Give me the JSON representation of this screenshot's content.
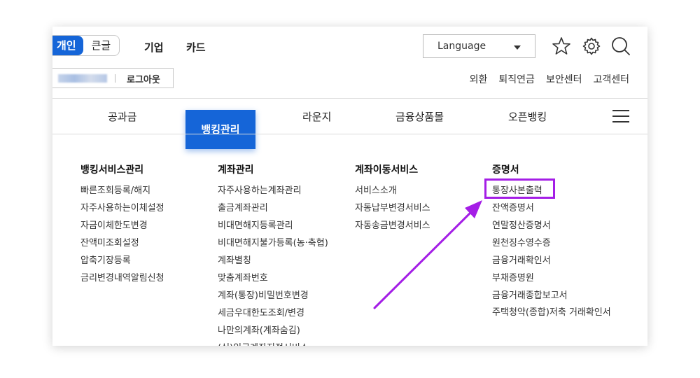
{
  "header": {
    "segment": {
      "active": "개인",
      "inactive": "큰글"
    },
    "nav_top": [
      "기업",
      "카드"
    ],
    "language": {
      "label": "Language"
    },
    "icons": [
      "star-icon",
      "gear-icon",
      "search-icon"
    ],
    "user": {
      "logout_label": "로그아웃"
    },
    "top_links": [
      "외환",
      "퇴직연금",
      "보안센터",
      "고객센터"
    ]
  },
  "main_nav": {
    "items": [
      "공과금",
      "뱅킹관리",
      "라운지",
      "금융상품몰",
      "오픈뱅킹"
    ],
    "active": "뱅킹관리"
  },
  "mega_menu": {
    "columns": [
      {
        "title": "뱅킹서비스관리",
        "items": [
          "빠른조회등록/해지",
          "자주사용하는이체설정",
          "자금이체한도변경",
          "잔액미조회설정",
          "압축기장등록",
          "금리변경내역알림신청"
        ]
      },
      {
        "title": "계좌관리",
        "items": [
          "자주사용하는계좌관리",
          "출금계좌관리",
          "비대면해지등록관리",
          "비대면해지불가등록(농·축협)",
          "계좌별칭",
          "맞춤계좌번호",
          "계좌(통장)비밀번호변경",
          "세금우대한도조회/변경",
          "나만의계좌(계좌숨김)",
          "(신)입금계좌지정서비스"
        ]
      },
      {
        "title": "계좌이동서비스",
        "items": [
          "서비스소개",
          "자동납부변경서비스",
          "자동송금변경서비스"
        ]
      },
      {
        "title": "증명서",
        "items": [
          "통장사본출력",
          "잔액증명서",
          "연말정산증명서",
          "원천징수영수증",
          "금융거래확인서",
          "부채증명원",
          "금융거래종합보고서",
          "주택청약(종합)저축 거래확인서"
        ]
      }
    ],
    "highlighted_item": "통장사본출력"
  },
  "colors": {
    "accent": "#1565d8",
    "annotation": "#a41ee6"
  }
}
